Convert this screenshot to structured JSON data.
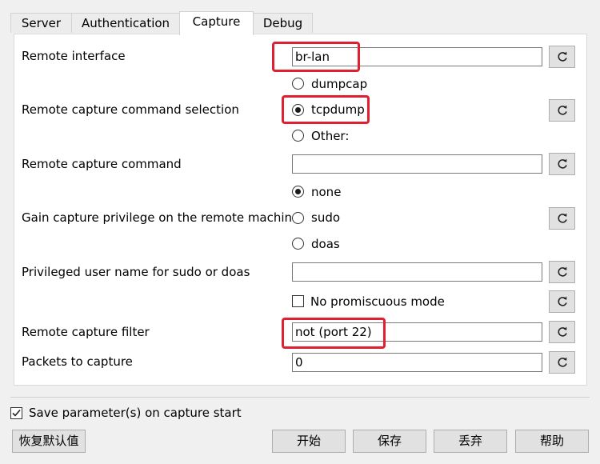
{
  "tabs": [
    "Server",
    "Authentication",
    "Capture",
    "Debug"
  ],
  "active_tab": "Capture",
  "capture": {
    "remote_interface": {
      "label": "Remote interface",
      "value": "br-lan"
    },
    "command_selection": {
      "label": "Remote capture command selection",
      "options": [
        "dumpcap",
        "tcpdump",
        "Other:"
      ],
      "selected": "tcpdump"
    },
    "remote_command": {
      "label": "Remote capture command",
      "value": ""
    },
    "privilege": {
      "label": "Gain capture privilege on the remote machine",
      "options": [
        "none",
        "sudo",
        "doas"
      ],
      "selected": "none"
    },
    "privileged_user": {
      "label": "Privileged user name for sudo or doas",
      "value": ""
    },
    "no_promiscuous": {
      "label": "No promiscuous mode",
      "checked": false
    },
    "capture_filter": {
      "label": "Remote capture filter",
      "value": "not (port 22)"
    },
    "packets": {
      "label": "Packets to capture",
      "value": "0"
    }
  },
  "save_params": {
    "label": "Save parameter(s) on capture start",
    "checked": true
  },
  "buttons": {
    "restore_defaults": "恢复默认值",
    "start": "开始",
    "save": "保存",
    "discard": "丢弃",
    "help": "帮助"
  },
  "colors": {
    "highlight": "#e02030",
    "panel": "#ffffff",
    "window": "#f0f0f0"
  },
  "icons": {
    "reset": "reset-icon",
    "check": "check-icon"
  }
}
